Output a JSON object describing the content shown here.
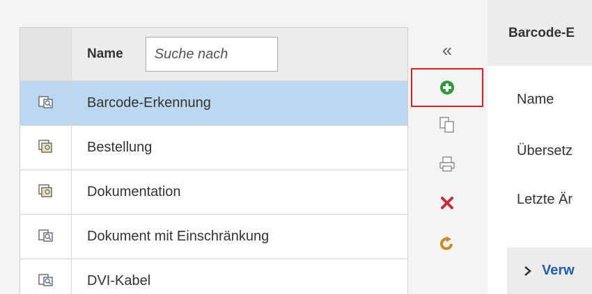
{
  "list": {
    "header": {
      "name_label": "Name",
      "search_placeholder": "Suche nach"
    },
    "rows": [
      {
        "label": "Barcode-Erkennung",
        "icon": "document-search-icon",
        "selected": true
      },
      {
        "label": "Bestellung",
        "icon": "document-group-icon",
        "selected": false
      },
      {
        "label": "Dokumentation",
        "icon": "document-group-icon",
        "selected": false
      },
      {
        "label": "Dokument mit Einschränkung",
        "icon": "document-search-icon",
        "selected": false
      },
      {
        "label": "DVI-Kabel",
        "icon": "document-search-icon",
        "selected": false
      }
    ]
  },
  "toolbar": {
    "collapse_glyph": "«",
    "buttons": [
      {
        "name": "add-icon",
        "color": "#2e9a3a",
        "highlighted": true
      },
      {
        "name": "copy-icon",
        "color": "#888888"
      },
      {
        "name": "print-icon",
        "color": "#888888"
      },
      {
        "name": "delete-icon",
        "color": "#c62d3a"
      },
      {
        "name": "refresh-icon",
        "color": "#c88a1e"
      }
    ]
  },
  "detail": {
    "title": "Barcode-E",
    "fields": [
      "Name",
      "Übersetz",
      "Letzte Är"
    ],
    "section_label": "Verw"
  },
  "colors": {
    "selected_row": "#bcd8f0",
    "highlight_border": "#e02020",
    "link": "#1f5fa8"
  }
}
